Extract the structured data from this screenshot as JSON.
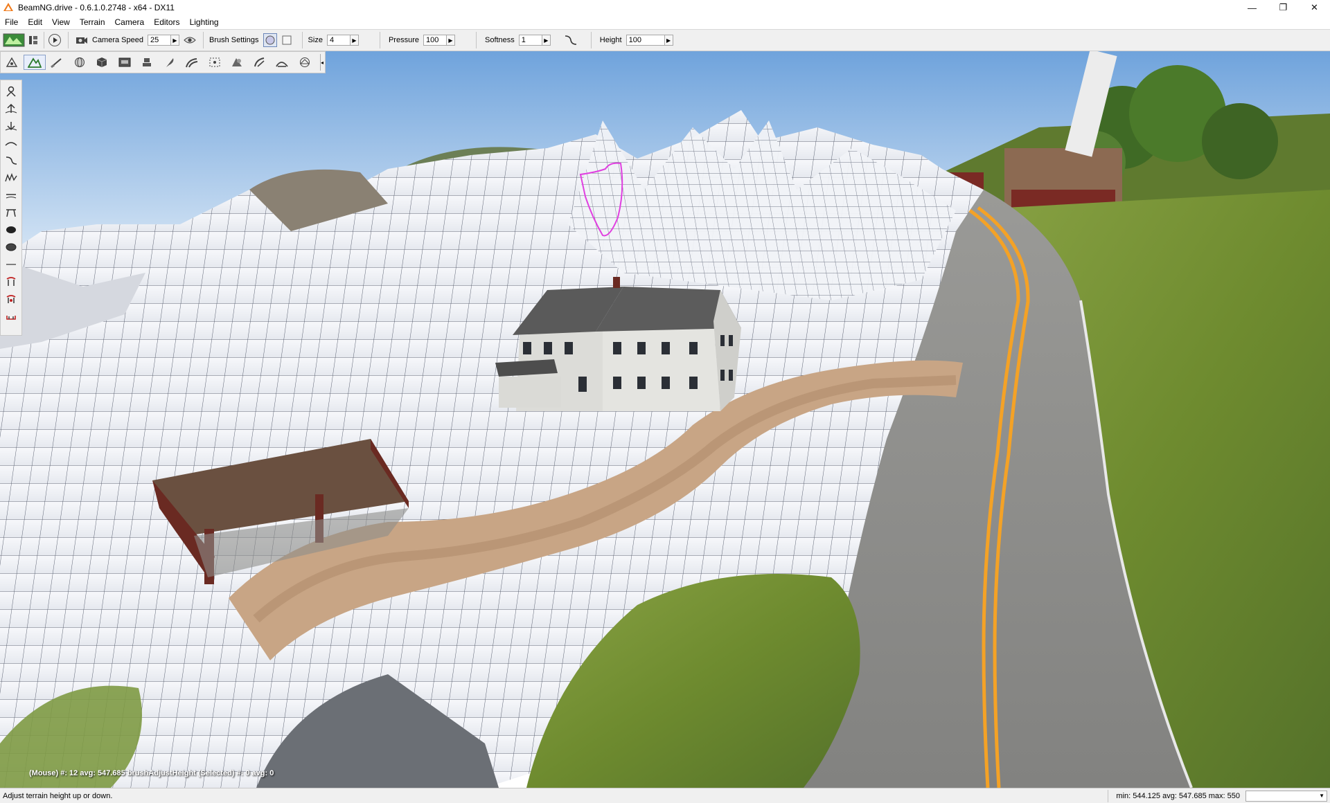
{
  "window": {
    "title": "BeamNG.drive - 0.6.1.0.2748 - x64 - DX11",
    "minimize": "—",
    "restore": "❐",
    "close": "✕"
  },
  "menu": [
    "File",
    "Edit",
    "View",
    "Terrain",
    "Camera",
    "Editors",
    "Lighting"
  ],
  "toolbar": {
    "camera_speed_label": "Camera Speed",
    "camera_speed_value": "25",
    "brush_settings_label": "Brush Settings",
    "size_label": "Size",
    "size_value": "4",
    "pressure_label": "Pressure",
    "pressure_value": "100",
    "softness_label": "Softness",
    "softness_value": "1",
    "height_label": "Height",
    "height_value": "100"
  },
  "tool_palette_icons": [
    "object-select-icon",
    "terrain-editor-icon",
    "terrain-painter-icon",
    "sphere-icon",
    "cube-icon",
    "sign-icon",
    "decal-icon",
    "forest-icon",
    "river-icon",
    "mesh-road-icon",
    "shape-icon",
    "road-icon",
    "path-icon",
    "navmesh-icon"
  ],
  "side_tools": [
    "grab-terrain-icon",
    "raise-height-icon",
    "lower-height-icon",
    "smooth-icon",
    "slope-icon",
    "noise-icon",
    "flatten-icon",
    "set-height-icon",
    "clear-terrain-icon",
    "restore-terrain-icon",
    "set-empty-icon",
    "set-average-icon",
    "paint-material-icon",
    "clear-material-icon"
  ],
  "viewport": {
    "readout": "(Mouse) #: 12  avg: 547.685 brushAdjustHeight   (Selected) #: 0  avg: 0"
  },
  "status": {
    "hint": "Adjust terrain height up or down.",
    "stats": "min: 544.125  avg: 547.685  max: 550"
  },
  "colors": {
    "chrome_bg": "#f0f0f0",
    "sky_top": "#6fa3dc",
    "sky_bottom": "#cfe1f4",
    "terrain_grid": "#f2f4f8",
    "road_asphalt": "#8b8b88",
    "road_line": "#f4a226",
    "grass": "#6f8a2f",
    "dirt_path": "#c8a585",
    "selection_outline": "#e040e0"
  }
}
